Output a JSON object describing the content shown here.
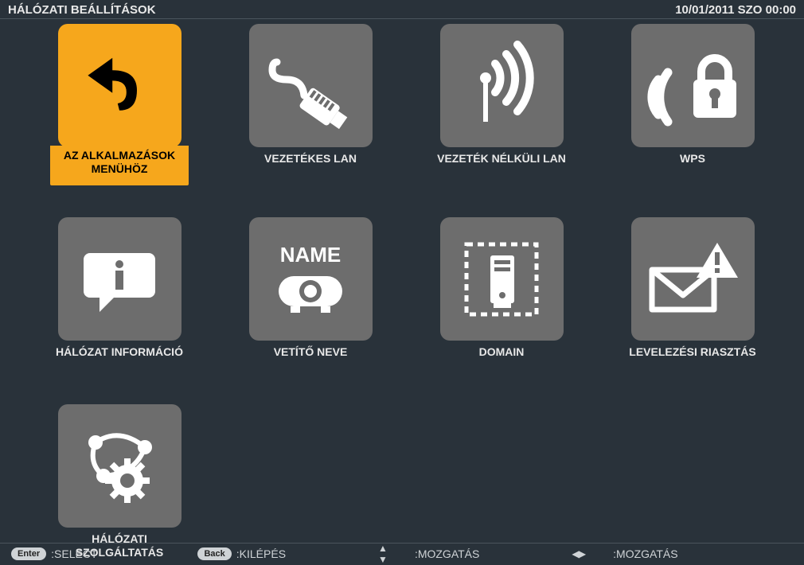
{
  "header": {
    "title": "HÁLÓZATI BEÁLLÍTÁSOK",
    "datetime": "10/01/2011 SZO 00:00"
  },
  "tiles": {
    "back": {
      "label": "AZ ALKALMAZÁSOK\nMENÜHÖZ",
      "selected": true
    },
    "wired": {
      "label": "VEZETÉKES LAN"
    },
    "wireless": {
      "label": "VEZETÉK NÉLKÜLI LAN"
    },
    "wps": {
      "label": "WPS"
    },
    "info": {
      "label": "HÁLÓZAT INFORMÁCIÓ"
    },
    "projname": {
      "label": "VETÍTŐ NEVE",
      "badge": "NAME"
    },
    "domain": {
      "label": "DOMAIN"
    },
    "mailalert": {
      "label": "LEVELEZÉSI RIASZTÁS"
    },
    "netservice": {
      "label": "HÁLÓZATI\nSZOLGÁLTATÁS"
    }
  },
  "footer": {
    "enter_pill": "Enter",
    "enter_label": ":SELECT",
    "back_pill": "Back",
    "back_label": ":KILÉPÉS",
    "move_v": ":MOZGATÁS",
    "move_h": ":MOZGATÁS"
  },
  "colors": {
    "accent": "#f6a71c",
    "tile": "#6d6d6d",
    "bg": "#29323a"
  }
}
